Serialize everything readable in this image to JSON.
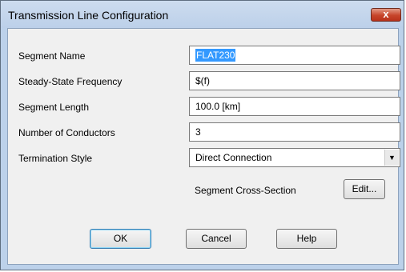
{
  "window": {
    "title": "Transmission Line Configuration",
    "close_glyph": "x"
  },
  "form": {
    "segment_name": {
      "label": "Segment Name",
      "value": "FLAT230"
    },
    "frequency": {
      "label": "Steady-State Frequency",
      "value": "$(f)"
    },
    "length": {
      "label": "Segment Length",
      "value": "100.0 [km]"
    },
    "conductors": {
      "label": "Number of Conductors",
      "value": "3"
    },
    "termination": {
      "label": "Termination Style",
      "value": "Direct Connection",
      "icon": "chevron-down-icon"
    },
    "cross_section": {
      "label": "Segment Cross-Section",
      "button": "Edit..."
    }
  },
  "buttons": {
    "ok": "OK",
    "cancel": "Cancel",
    "help": "Help"
  },
  "colors": {
    "frame": "#bcd1ea",
    "client": "#f0f0f0",
    "selection": "#3399ff",
    "close_red": "#c7442a"
  }
}
